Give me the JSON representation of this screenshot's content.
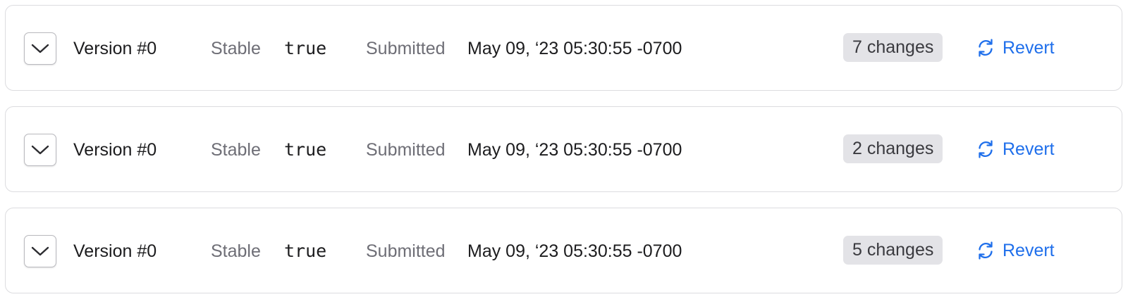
{
  "versions": [
    {
      "title": "Version #0",
      "stable_label": "Stable",
      "stable_value": "true",
      "submitted_label": "Submitted",
      "submitted_value": "May 09, ‘23 05:30:55 -0700",
      "changes": "7 changes",
      "revert_label": "Revert"
    },
    {
      "title": "Version #0",
      "stable_label": "Stable",
      "stable_value": "true",
      "submitted_label": "Submitted",
      "submitted_value": "May 09, ‘23 05:30:55 -0700",
      "changes": "2 changes",
      "revert_label": "Revert"
    },
    {
      "title": "Version #0",
      "stable_label": "Stable",
      "stable_value": "true",
      "submitted_label": "Submitted",
      "submitted_value": "May 09, ‘23 05:30:55 -0700",
      "changes": "5 changes",
      "revert_label": "Revert"
    }
  ],
  "icons": {
    "expand": "chevron-down-icon",
    "revert": "refresh-icon"
  },
  "colors": {
    "accent": "#1f6feb",
    "muted_text": "#6e6e76",
    "badge_bg": "#e3e3e7",
    "border": "#dcdcdf"
  }
}
